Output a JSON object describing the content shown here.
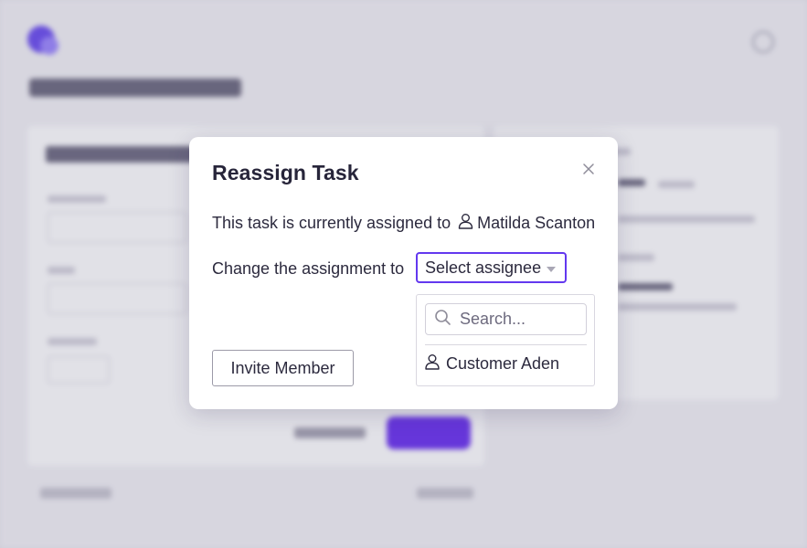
{
  "modal": {
    "title": "Reassign Task",
    "current_label": "This task is currently assigned to",
    "current_assignee": "Matilda Scanton",
    "change_label": "Change the assignment to",
    "select_value": "Select assignee",
    "search_placeholder": "Search...",
    "options": [
      "Customer Aden"
    ],
    "invite_button": "Invite Member",
    "icons": {
      "close": "close-icon",
      "user": "user-icon",
      "search": "search-icon",
      "dropdown": "chevron-down-icon"
    }
  },
  "colors": {
    "accent": "#6338ef",
    "primary_button": "#6a2ff0",
    "text": "#2c2a3e"
  }
}
